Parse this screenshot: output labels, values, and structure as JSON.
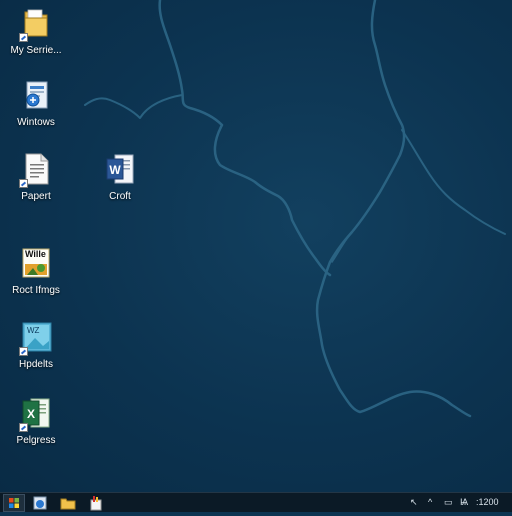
{
  "desktop": {
    "wallpaper": {
      "background": "#0c3350",
      "vein_color": "#2f6a8a"
    },
    "icons": [
      {
        "label": "My Serrie...",
        "icon": "folder-icon"
      },
      {
        "label": "Wintows",
        "icon": "installer-icon"
      },
      {
        "label": "Papert",
        "icon": "document-icon"
      },
      {
        "label": "Croft",
        "icon": "word-icon"
      },
      {
        "label": "Roct Ifmgs",
        "icon": "image-icon"
      },
      {
        "label": "Hpdelts",
        "icon": "image-icon"
      },
      {
        "label": "Pelgress",
        "icon": "excel-icon"
      }
    ],
    "icon_badges": {
      "roct": "Wille",
      "hpdelts": "WZ"
    }
  },
  "taskbar": {
    "background": "#0b1a26",
    "pinned": [
      {
        "name": "windows-start-icon"
      },
      {
        "name": "installer-icon"
      },
      {
        "name": "folder-icon"
      },
      {
        "name": "paint-icon"
      }
    ],
    "tray": {
      "chevron": "^",
      "text": "Ѩ",
      "clock": ":1200"
    }
  }
}
